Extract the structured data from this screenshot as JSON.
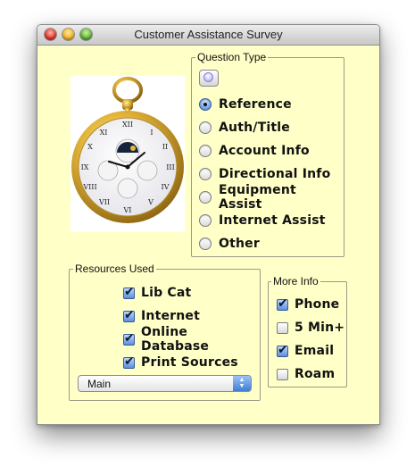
{
  "window": {
    "title": "Customer Assistance Survey"
  },
  "question_type": {
    "label": "Question Type",
    "options": [
      {
        "label": "Reference",
        "selected": true
      },
      {
        "label": "Auth/Title",
        "selected": false
      },
      {
        "label": "Account Info",
        "selected": false
      },
      {
        "label": "Directional Info",
        "selected": false
      },
      {
        "label": "Equipment Assist",
        "selected": false
      },
      {
        "label": "Internet Assist",
        "selected": false
      },
      {
        "label": "Other",
        "selected": false
      }
    ]
  },
  "resources": {
    "label": "Resources Used",
    "items": [
      {
        "label": "Lib Cat",
        "checked": true
      },
      {
        "label": "Internet",
        "checked": true
      },
      {
        "label": "Online Database",
        "checked": true
      },
      {
        "label": "Print Sources",
        "checked": true
      }
    ],
    "popup_value": "Main"
  },
  "more_info": {
    "label": "More Info",
    "items": [
      {
        "label": "Phone",
        "checked": true
      },
      {
        "label": "5 Min+",
        "checked": false
      },
      {
        "label": "Email",
        "checked": true
      },
      {
        "label": "Roam",
        "checked": false
      }
    ]
  },
  "image": {
    "icon": "pocket-watch-image"
  },
  "colors": {
    "window_bg": "#ffffc8",
    "accent": "#5c8ee0"
  }
}
